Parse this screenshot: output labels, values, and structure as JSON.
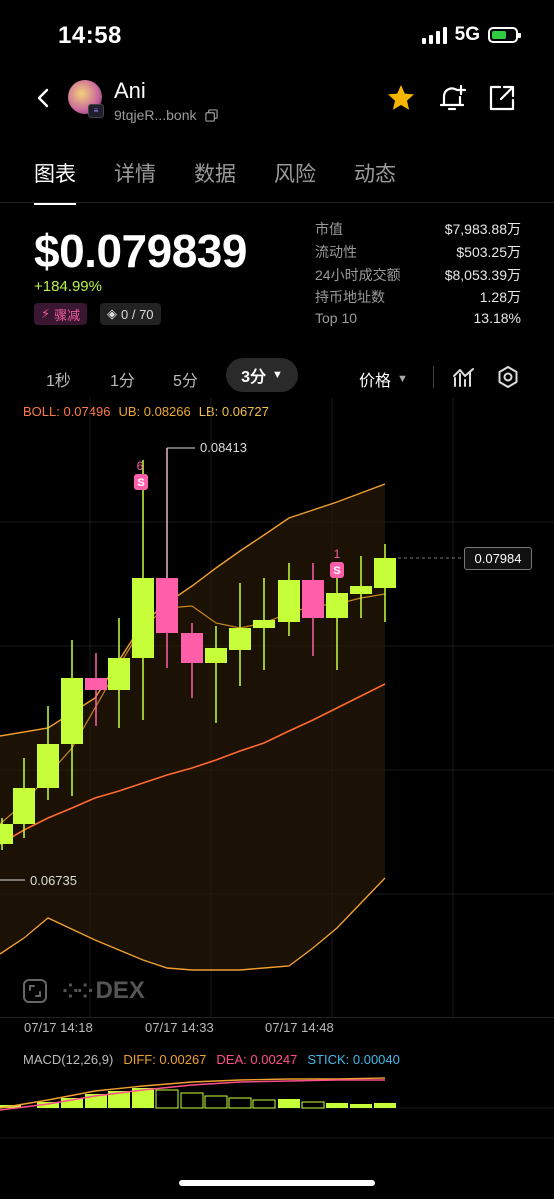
{
  "status": {
    "time": "14:58",
    "network": "5G"
  },
  "header": {
    "name": "Ani",
    "address": "9tqjeR...bonk",
    "icons": [
      "back-icon",
      "star-icon",
      "bell-add-icon",
      "share-icon",
      "copy-icon"
    ],
    "star_color": "#f7b500"
  },
  "tabs": [
    "图表",
    "详情",
    "数据",
    "风险",
    "动态"
  ],
  "active_tab": "图表",
  "price": {
    "value": "$0.079839",
    "change": "+184.99%",
    "change_color": "#b7f34a"
  },
  "badges": {
    "pump": "骤减",
    "audit": "0 / 70"
  },
  "stats": [
    {
      "k": "市值",
      "v": "$7,983.88万"
    },
    {
      "k": "流动性",
      "v": "$503.25万"
    },
    {
      "k": "24小时成交额",
      "v": "$8,053.39万"
    },
    {
      "k": "持币地址数",
      "v": "1.28万"
    },
    {
      "k": "Top 10",
      "v": "13.18%"
    }
  ],
  "timeframes": [
    "1秒",
    "1分",
    "5分",
    "3分"
  ],
  "active_timeframe": "3分",
  "price_mode": "价格",
  "boll": {
    "boll": "BOLL: 0.07496",
    "ub": "UB: 0.08266",
    "lb": "LB: 0.06727"
  },
  "macd": {
    "label": "MACD(12,26,9)",
    "diff": "DIFF: 0.00267",
    "dea": "DEA: 0.00247",
    "stick": "STICK: 0.00040"
  },
  "x_labels": [
    "07/17 14:18",
    "07/17 14:33",
    "07/17 14:48"
  ],
  "chart_labels": {
    "high": "0.08413",
    "low": "0.06735",
    "last": "0.07984",
    "sell_marker_1": "6",
    "sell_marker_2": "1",
    "sell_badge": "S"
  },
  "watermark": "DEX",
  "colors": {
    "up": "#c6ff3a",
    "down": "#ff5fa8",
    "boll_mid": "#ff6a2e",
    "boll_band": "#f0a030"
  }
}
